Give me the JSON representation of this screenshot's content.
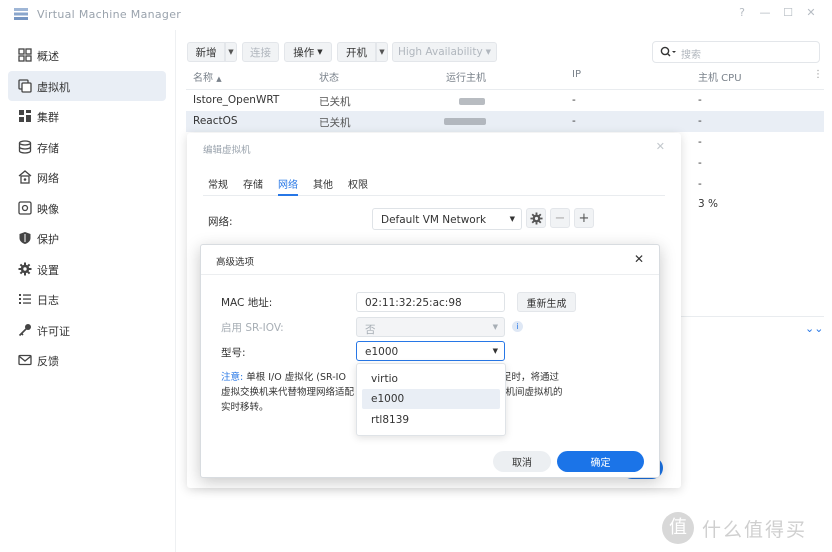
{
  "app": {
    "title": "Virtual Machine Manager"
  },
  "window_controls": {
    "help": "?",
    "minimize": "—",
    "maximize": "☐",
    "close": "✕"
  },
  "sidebar": {
    "items": [
      {
        "label": "概述",
        "icon": "overview-icon"
      },
      {
        "label": "虚拟机",
        "icon": "vm-icon",
        "active": true
      },
      {
        "label": "集群",
        "icon": "cluster-icon"
      },
      {
        "label": "存储",
        "icon": "storage-icon"
      },
      {
        "label": "网络",
        "icon": "network-icon"
      },
      {
        "label": "映像",
        "icon": "image-icon"
      },
      {
        "label": "保护",
        "icon": "shield-icon"
      },
      {
        "label": "设置",
        "icon": "gear-icon"
      },
      {
        "label": "日志",
        "icon": "log-icon"
      },
      {
        "label": "许可证",
        "icon": "key-icon"
      },
      {
        "label": "反馈",
        "icon": "mail-icon"
      }
    ]
  },
  "toolbar": {
    "new": "新增",
    "connect": "连接",
    "action": "操作",
    "power": "开机",
    "ha": "High Availability"
  },
  "search": {
    "placeholder": "搜索"
  },
  "table": {
    "headers": [
      "名称",
      "状态",
      "运行主机",
      "IP",
      "主机 CPU"
    ],
    "rows": [
      {
        "name": "Istore_OpenWRT",
        "status": "已关机",
        "ip": "-",
        "cpu": "-"
      },
      {
        "name": "ReactOS",
        "status": "已关机",
        "ip": "-",
        "cpu": "-"
      }
    ],
    "extra_cpu": [
      "-",
      "-",
      "-",
      "3 %"
    ]
  },
  "edit_dialog": {
    "title": "编辑虚拟机",
    "tabs": [
      "常规",
      "存储",
      "网络",
      "其他",
      "权限"
    ],
    "active_tab": "网络",
    "network_label": "网络:",
    "network_value": "Default VM Network"
  },
  "adv_dialog": {
    "title": "高级选项",
    "mac_label": "MAC 地址:",
    "mac_value": "02:11:32:25:ac:98",
    "regen_label": "重新生成",
    "sriov_label": "启用 SR-IOV:",
    "sriov_value": "否",
    "model_label": "型号:",
    "model_value": "e1000",
    "note_key": "注意:",
    "note_line1": "单根 I/O 虚拟化 (SR-IO",
    "note_line1b": "能。当硬件资源不足时，将通过",
    "note_line2": "虚拟交换机来代替物理网络适配",
    "note_line2b": "后，将不支持主机间虚拟机的",
    "note_line3": "实时移转。",
    "options": [
      "virtio",
      "e1000",
      "rtl8139"
    ],
    "cancel": "取消",
    "ok": "确定"
  },
  "watermark": {
    "text": "什么值得买",
    "badge": "值"
  }
}
